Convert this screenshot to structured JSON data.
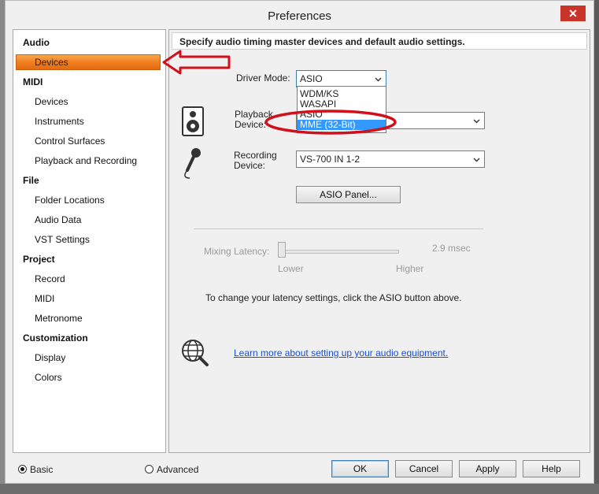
{
  "window": {
    "title": "Preferences",
    "close_glyph": "✕"
  },
  "nav": {
    "selected": "Devices",
    "groups": [
      {
        "label": "Audio",
        "items": [
          "Devices"
        ]
      },
      {
        "label": "MIDI",
        "items": [
          "Devices",
          "Instruments",
          "Control Surfaces",
          "Playback and Recording"
        ]
      },
      {
        "label": "File",
        "items": [
          "Folder Locations",
          "Audio Data",
          "VST Settings"
        ]
      },
      {
        "label": "Project",
        "items": [
          "Record",
          "MIDI",
          "Metronome"
        ]
      },
      {
        "label": "Customization",
        "items": [
          "Display",
          "Colors"
        ]
      }
    ]
  },
  "panel": {
    "heading": "Specify audio timing master devices and default audio settings.",
    "driver_mode_label": "Driver Mode:",
    "driver_mode_value": "ASIO",
    "driver_options": [
      "WDM/KS",
      "WASAPI",
      "ASIO",
      "MME (32-Bit)"
    ],
    "driver_highlighted": "MME (32-Bit)",
    "playback_label_1": "Playback",
    "playback_label_2": "Device:",
    "recording_label_1": "Recording",
    "recording_label_2": "Device:",
    "recording_value": "VS-700 IN 1-2",
    "asio_panel_button": "ASIO Panel...",
    "mixing_latency_label": "Mixing Latency:",
    "mixing_latency_value": "2.9 msec",
    "slider_lower": "Lower",
    "slider_higher": "Higher",
    "latency_note": "To change your latency settings, click the ASIO button above.",
    "learn_more_link": "Learn more about setting up your audio equipment."
  },
  "footer": {
    "mode_basic": "Basic",
    "mode_advanced": "Advanced",
    "mode_selected": "Basic",
    "ok": "OK",
    "cancel": "Cancel",
    "apply": "Apply",
    "help": "Help"
  },
  "annotations": {
    "accent": "#d0101a"
  }
}
